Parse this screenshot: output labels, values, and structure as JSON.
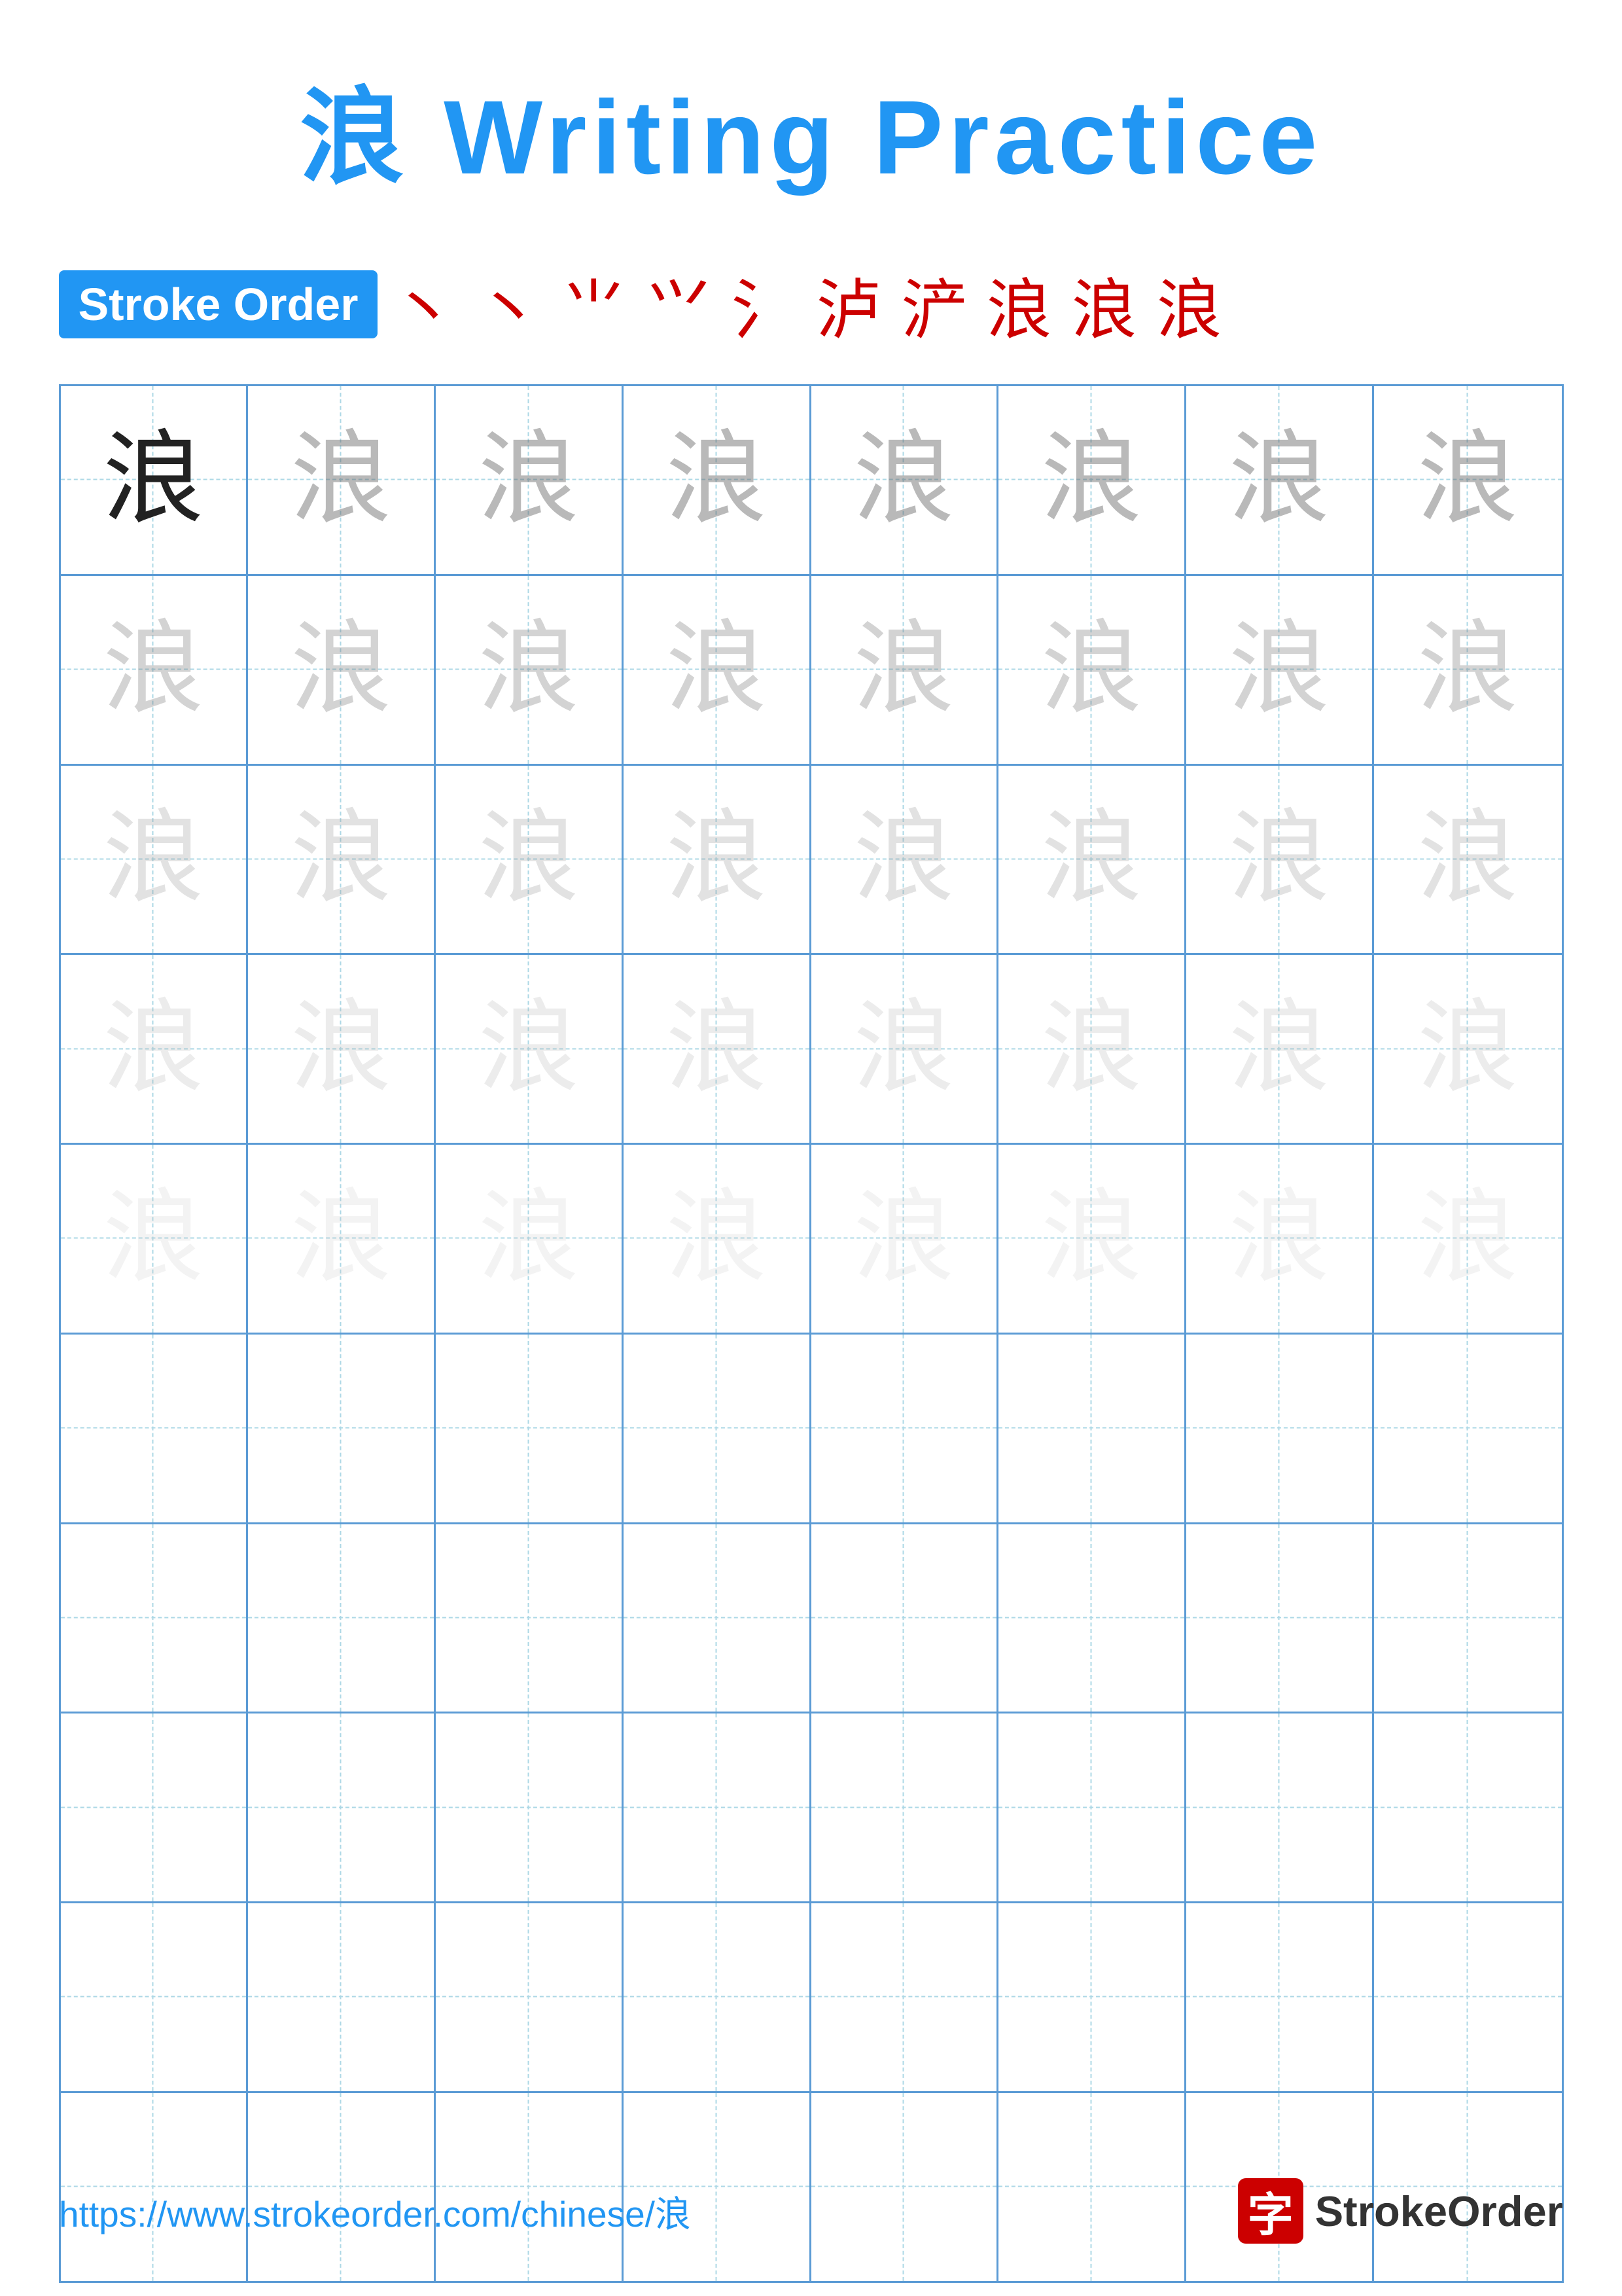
{
  "title": {
    "chinese": "浪",
    "english": "Writing Practice"
  },
  "stroke_order": {
    "badge_label": "Stroke Order",
    "steps": [
      "丶",
      "丶",
      "⺌",
      "⺍",
      "氵",
      "泸",
      "浐",
      "浪",
      "浪",
      "浪"
    ]
  },
  "grid": {
    "rows": 10,
    "cols": 8,
    "character": "浪",
    "guide_rows": 5,
    "empty_rows": 5
  },
  "footer": {
    "url": "https://www.strokeorder.com/chinese/浪",
    "logo_char": "字",
    "logo_text": "StrokeOrder"
  }
}
